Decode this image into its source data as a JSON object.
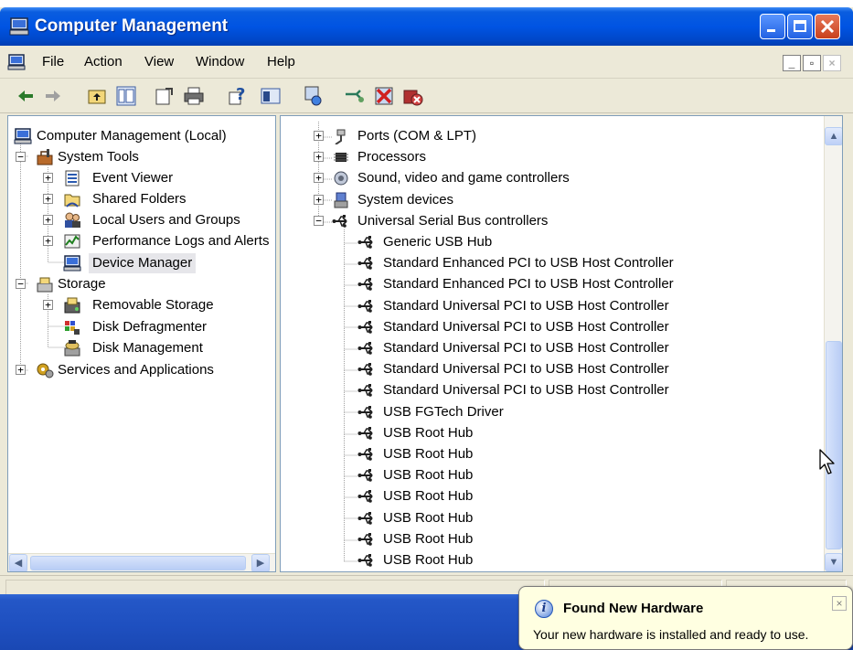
{
  "window": {
    "title": "Computer Management"
  },
  "menu": [
    "File",
    "Action",
    "View",
    "Window",
    "Help"
  ],
  "left_tree": [
    {
      "label": "Computer Management (Local)",
      "indent": 0,
      "expander": "",
      "icon": "computer-icon",
      "name": "tree-computer-management-local"
    },
    {
      "label": "System Tools",
      "indent": 1,
      "expander": "−",
      "icon": "toolbox-icon",
      "name": "tree-system-tools"
    },
    {
      "label": "Event Viewer",
      "indent": 2,
      "expander": "+",
      "icon": "event-viewer-icon",
      "name": "tree-event-viewer"
    },
    {
      "label": "Shared Folders",
      "indent": 2,
      "expander": "+",
      "icon": "shared-folder-icon",
      "name": "tree-shared-folders"
    },
    {
      "label": "Local Users and Groups",
      "indent": 2,
      "expander": "+",
      "icon": "users-icon",
      "name": "tree-local-users-and-groups"
    },
    {
      "label": "Performance Logs and Alerts",
      "indent": 2,
      "expander": "+",
      "icon": "performance-icon",
      "name": "tree-performance-logs"
    },
    {
      "label": "Device Manager",
      "indent": 2,
      "expander": "",
      "icon": "device-manager-icon",
      "name": "tree-device-manager",
      "selected": true
    },
    {
      "label": "Storage",
      "indent": 1,
      "expander": "−",
      "icon": "storage-icon",
      "name": "tree-storage"
    },
    {
      "label": "Removable Storage",
      "indent": 2,
      "expander": "+",
      "icon": "removable-storage-icon",
      "name": "tree-removable-storage"
    },
    {
      "label": "Disk Defragmenter",
      "indent": 2,
      "expander": "",
      "icon": "defrag-icon",
      "name": "tree-disk-defragmenter"
    },
    {
      "label": "Disk Management",
      "indent": 2,
      "expander": "",
      "icon": "disk-management-icon",
      "name": "tree-disk-management"
    },
    {
      "label": "Services and Applications",
      "indent": 1,
      "expander": "+",
      "icon": "services-icon",
      "name": "tree-services-and-applications"
    }
  ],
  "device_tree": [
    {
      "label": "Ports (COM & LPT)",
      "level": 0,
      "expander": "+",
      "icon": "port-icon"
    },
    {
      "label": "Processors",
      "level": 0,
      "expander": "+",
      "icon": "processor-icon"
    },
    {
      "label": "Sound, video and game controllers",
      "level": 0,
      "expander": "+",
      "icon": "sound-icon"
    },
    {
      "label": "System devices",
      "level": 0,
      "expander": "+",
      "icon": "system-device-icon"
    },
    {
      "label": "Universal Serial Bus controllers",
      "level": 0,
      "expander": "−",
      "icon": "usb-icon"
    },
    {
      "label": "Generic USB Hub",
      "level": 1,
      "expander": "",
      "icon": "usb-icon"
    },
    {
      "label": "Standard Enhanced PCI to USB Host Controller",
      "level": 1,
      "expander": "",
      "icon": "usb-icon"
    },
    {
      "label": "Standard Enhanced PCI to USB Host Controller",
      "level": 1,
      "expander": "",
      "icon": "usb-icon"
    },
    {
      "label": "Standard Universal PCI to USB Host Controller",
      "level": 1,
      "expander": "",
      "icon": "usb-icon"
    },
    {
      "label": "Standard Universal PCI to USB Host Controller",
      "level": 1,
      "expander": "",
      "icon": "usb-icon"
    },
    {
      "label": "Standard Universal PCI to USB Host Controller",
      "level": 1,
      "expander": "",
      "icon": "usb-icon"
    },
    {
      "label": "Standard Universal PCI to USB Host Controller",
      "level": 1,
      "expander": "",
      "icon": "usb-icon"
    },
    {
      "label": "Standard Universal PCI to USB Host Controller",
      "level": 1,
      "expander": "",
      "icon": "usb-icon"
    },
    {
      "label": "USB FGTech Driver",
      "level": 1,
      "expander": "",
      "icon": "usb-icon"
    },
    {
      "label": "USB Root Hub",
      "level": 1,
      "expander": "",
      "icon": "usb-icon"
    },
    {
      "label": "USB Root Hub",
      "level": 1,
      "expander": "",
      "icon": "usb-icon"
    },
    {
      "label": "USB Root Hub",
      "level": 1,
      "expander": "",
      "icon": "usb-icon"
    },
    {
      "label": "USB Root Hub",
      "level": 1,
      "expander": "",
      "icon": "usb-icon"
    },
    {
      "label": "USB Root Hub",
      "level": 1,
      "expander": "",
      "icon": "usb-icon"
    },
    {
      "label": "USB Root Hub",
      "level": 1,
      "expander": "",
      "icon": "usb-icon"
    },
    {
      "label": "USB Root Hub",
      "level": 1,
      "expander": "",
      "icon": "usb-icon"
    }
  ],
  "notification": {
    "title": "Found New Hardware",
    "message": "Your new hardware is installed and ready to use.",
    "icon": "info-icon"
  },
  "colors": {
    "titlebar": "#0054e3",
    "selection": "#e6e6ea",
    "balloon": "#ffffe1",
    "taskbar": "#2457c7"
  }
}
